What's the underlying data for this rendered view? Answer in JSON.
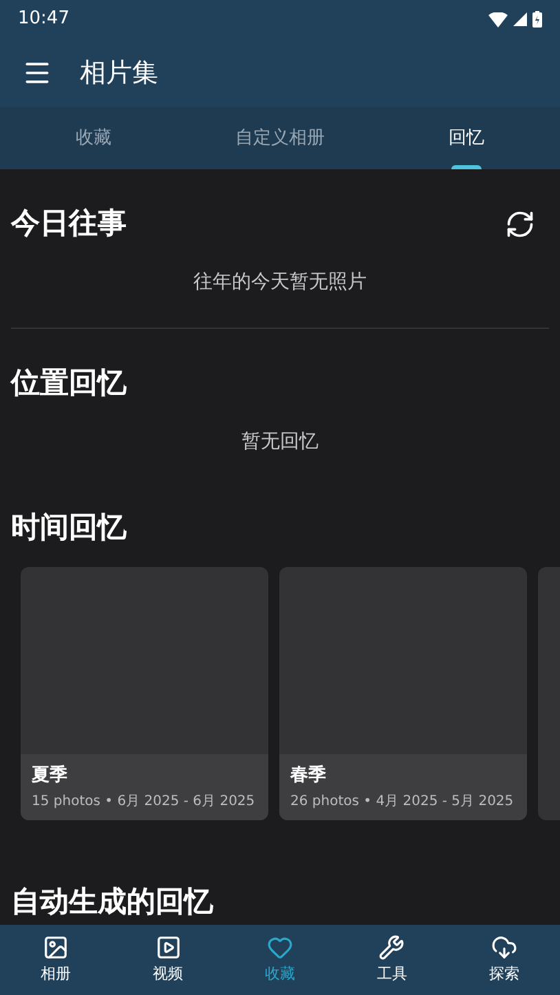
{
  "status_bar": {
    "time": "10:47"
  },
  "app_bar": {
    "title": "相片集"
  },
  "tabs": [
    {
      "label": "收藏",
      "selected": false
    },
    {
      "label": "自定义相册",
      "selected": false
    },
    {
      "label": "回忆",
      "selected": true
    }
  ],
  "sections": [
    {
      "kind": "today",
      "title": "今日往事",
      "empty_text": "往年的今天暂无照片"
    },
    {
      "kind": "empty",
      "title": "位置回忆",
      "empty_text": "暂无回忆"
    },
    {
      "kind": "cards",
      "title": "时间回忆",
      "cards": [
        {
          "title": "夏季",
          "subtitle": "15 photos • 6月 2025 - 6月 2025"
        },
        {
          "title": "春季",
          "subtitle": "26 photos • 4月 2025 - 5月 2025"
        }
      ]
    },
    {
      "kind": "heading",
      "title": "自动生成的回忆"
    }
  ],
  "bottom_nav": [
    {
      "label": "相册",
      "selected": false
    },
    {
      "label": "视频",
      "selected": false
    },
    {
      "label": "收藏",
      "selected": true
    },
    {
      "label": "工具",
      "selected": false
    },
    {
      "label": "探索",
      "selected": false
    }
  ]
}
